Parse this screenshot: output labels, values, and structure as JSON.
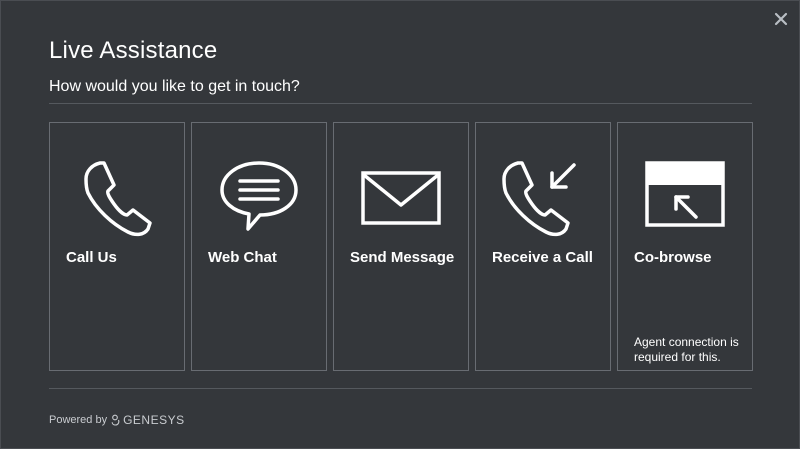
{
  "dialog": {
    "title": "Live Assistance",
    "subtitle": "How would you like to get in touch?",
    "close_icon": "close-icon"
  },
  "options": [
    {
      "label": "Call Us",
      "icon": "phone-icon"
    },
    {
      "label": "Web Chat",
      "icon": "chat-bubble-icon"
    },
    {
      "label": "Send Message",
      "icon": "envelope-icon"
    },
    {
      "label": "Receive a Call",
      "icon": "incoming-call-icon"
    },
    {
      "label": "Co-browse",
      "icon": "cobrowse-window-icon",
      "note": "Agent connection is required for this."
    }
  ],
  "footer": {
    "powered_by": "Powered by",
    "brand": "GENESYS",
    "brand_icon": "genesys-logo-icon"
  },
  "colors": {
    "background": "#34373b",
    "card_border": "#686c72",
    "divider": "#55595e",
    "text": "#ffffff",
    "footer_text": "#c9ccd0"
  }
}
